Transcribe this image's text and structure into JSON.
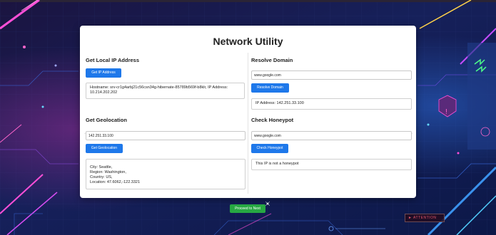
{
  "app": {
    "title": "Network Utility"
  },
  "local_ip": {
    "title": "Get Local IP Address",
    "button_label": "Get IP Address",
    "result": "Hostname: srv-cr1g4arbj21c56csn34g-hibernate-85789b569f-b8klr, IP Address: 10.214.202.202"
  },
  "resolve_domain": {
    "title": "Resolve Domain",
    "input_value": "www.google.com",
    "button_label": "Resolve Domain",
    "result": "IP Address: 142.251.33.100"
  },
  "geolocation": {
    "title": "Get Geolocation",
    "input_value": "142.251.33.100",
    "button_label": "Get Geolocation",
    "result_lines": [
      "City: Seattle,",
      "Region: Washington,",
      "Country: US,",
      "Location: 47.6062,-122.3321"
    ]
  },
  "honeypot": {
    "title": "Check Honeypot",
    "input_value": "www.google.com",
    "button_label": "Check Honeypot",
    "result": "This IP is not a honeypot"
  },
  "footer": {
    "next_button_label": "Proceed to Next"
  },
  "background": {
    "badge_text": "► ATTENTION"
  },
  "colors": {
    "primary_button": "#1e78ea",
    "next_button": "#27a843",
    "card_background": "#ffffff",
    "page_background": "#141a45"
  }
}
